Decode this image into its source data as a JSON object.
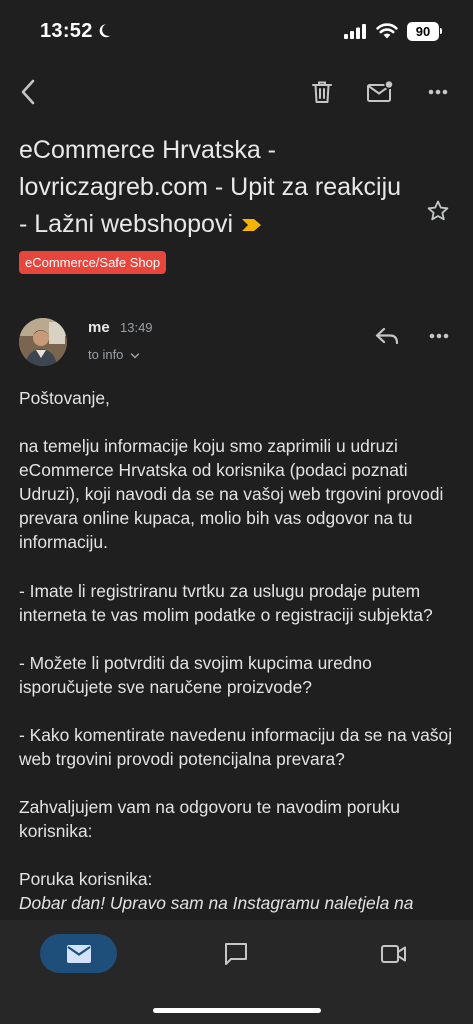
{
  "status_bar": {
    "time": "13:52",
    "battery": "90",
    "icons": [
      "moon-icon",
      "signal-icon",
      "wifi-icon",
      "battery-icon"
    ]
  },
  "toolbar": {
    "icons": [
      "back-icon",
      "trash-icon",
      "mark-unread-icon",
      "more-icon"
    ]
  },
  "email": {
    "subject": "eCommerce Hrvatska - lovriczagreb.com - Upit za reakciju - Lažni webshopovi",
    "label": "eCommerce/Safe Shop",
    "sender": "me",
    "time": "13:49",
    "recipient": "to info",
    "body": {
      "greeting": "Poštovanje,",
      "intro": "na temelju informacije koju smo zaprimili u udruzi eCommerce Hrvatska od korisnika (podaci poznati Udruzi), koji navodi da se na vašoj web trgovini provodi prevara online kupaca, molio bih vas odgovor na tu informaciju.",
      "q1": "- Imate li registriranu tvrtku za uslugu prodaje putem interneta te vas molim podatke o registraciji subjekta?",
      "q2": "- Možete li potvrditi da svojim kupcima uredno isporučujete sve naručene proizvode?",
      "q3": "- Kako komentirate navedenu informaciju da se na vašoj web trgovini provodi potencijalna prevara?",
      "thanks": "Zahvaljujem vam na odgovoru te navodim poruku korisnika:",
      "msg_heading": "Poruka korisnika:",
      "msg_text": "Dobar dan! Upravo sam na Instagramu naletjela na"
    }
  },
  "colors": {
    "background": "#1f1f1f",
    "label_chip": "#e8453c",
    "importance_marker": "#f5b400",
    "nav_active": "#1e4f7a"
  }
}
